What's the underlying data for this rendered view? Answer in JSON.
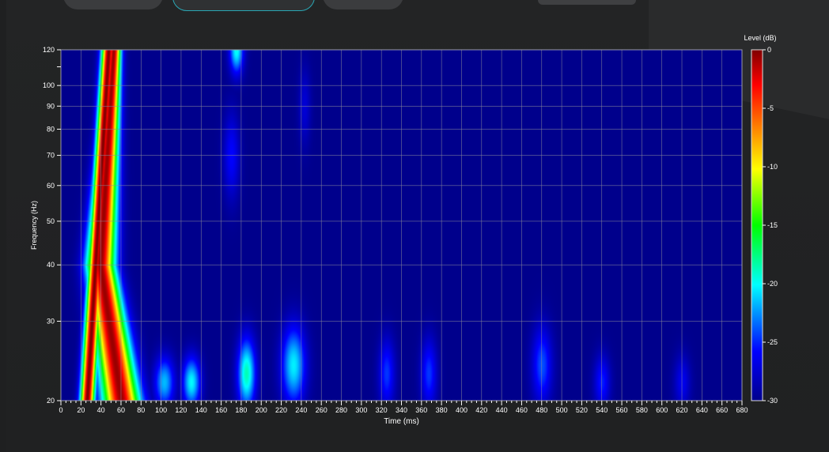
{
  "chart_data": {
    "type": "heatmap",
    "title": "",
    "xlabel": "Time (ms)",
    "ylabel": "Frequency (Hz)",
    "xlim": [
      0,
      680
    ],
    "ylim": [
      20,
      120
    ],
    "y_scale": "log",
    "grid": true,
    "x_ticks": [
      0,
      20,
      40,
      60,
      80,
      100,
      120,
      140,
      160,
      180,
      200,
      220,
      240,
      260,
      280,
      300,
      320,
      340,
      360,
      380,
      400,
      420,
      440,
      460,
      480,
      500,
      520,
      540,
      560,
      580,
      600,
      620,
      640,
      660,
      680
    ],
    "y_ticks": [
      20,
      30,
      40,
      50,
      60,
      70,
      80,
      90,
      100,
      120
    ],
    "colorbar": {
      "label": "Level (dB)",
      "range": [
        -30,
        0
      ],
      "ticks": [
        0,
        -5,
        -10,
        -15,
        -20,
        -25,
        -30
      ]
    },
    "peaks": [
      {
        "time_ms": 35,
        "freq_hz": 30,
        "level_db": 0
      },
      {
        "time_ms": 60,
        "freq_hz": 30,
        "level_db": 0
      },
      {
        "time_ms": 130,
        "freq_hz": 22,
        "level_db": -22
      },
      {
        "time_ms": 185,
        "freq_hz": 22,
        "level_db": -21
      },
      {
        "time_ms": 230,
        "freq_hz": 23,
        "level_db": -22
      },
      {
        "time_ms": 175,
        "freq_hz": 118,
        "level_db": -20
      },
      {
        "time_ms": 325,
        "freq_hz": 22,
        "level_db": -25
      },
      {
        "time_ms": 365,
        "freq_hz": 22,
        "level_db": -25
      },
      {
        "time_ms": 480,
        "freq_hz": 23,
        "level_db": -25
      },
      {
        "time_ms": 540,
        "freq_hz": 21,
        "level_db": -26
      },
      {
        "time_ms": 620,
        "freq_hz": 21,
        "level_db": -27
      }
    ],
    "floor_db": -30
  },
  "colors": {
    "background": "#1f2021",
    "plot_floor": "#00008c",
    "grid": "#8a8a9a",
    "colormap": [
      "#00008c",
      "#0000ff",
      "#00ffff",
      "#00ff00",
      "#ffff00",
      "#ff8000",
      "#ff0000",
      "#800000"
    ]
  }
}
